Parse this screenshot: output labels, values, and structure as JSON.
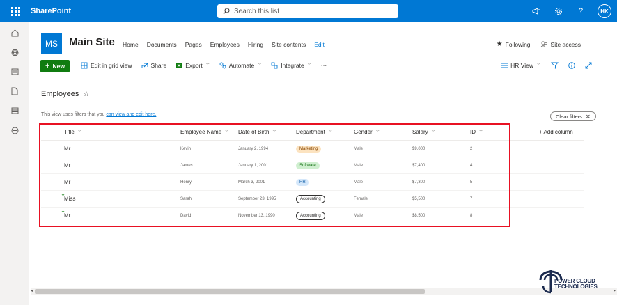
{
  "suite": {
    "app_name": "SharePoint",
    "search_placeholder": "Search this list",
    "avatar_initials": "HK"
  },
  "site": {
    "logo_initials": "MS",
    "title": "Main Site",
    "nav": [
      "Home",
      "Documents",
      "Pages",
      "Employees",
      "Hiring",
      "Site contents"
    ],
    "edit_label": "Edit",
    "following_label": "Following",
    "site_access_label": "Site access"
  },
  "commandbar": {
    "new_label": "New",
    "edit_grid_label": "Edit in grid view",
    "share_label": "Share",
    "export_label": "Export",
    "automate_label": "Automate",
    "integrate_label": "Integrate",
    "more_label": "···",
    "view_label": "HR View"
  },
  "list": {
    "title": "Employees",
    "filter_note": "This view uses filters that you ",
    "filter_link": "can view and edit here.",
    "clear_filters_label": "Clear filters"
  },
  "table": {
    "columns": [
      "Title",
      "Employee Name",
      "Date of Birth",
      "Department",
      "Gender",
      "Salary",
      "ID"
    ],
    "add_column_label": "+ Add column",
    "rows": [
      {
        "title": "Mr",
        "name": "Kevin",
        "dob": "January 2, 1994",
        "department": "Marketing",
        "dept_style": "marketing",
        "gender": "Male",
        "salary": "$9,000",
        "id": "2",
        "new": false
      },
      {
        "title": "Mr",
        "name": "James",
        "dob": "January 1, 2001",
        "department": "Software",
        "dept_style": "software",
        "gender": "Male",
        "salary": "$7,400",
        "id": "4",
        "new": false
      },
      {
        "title": "Mr",
        "name": "Henry",
        "dob": "March 3, 2001",
        "department": "HR",
        "dept_style": "hr",
        "gender": "Male",
        "salary": "$7,300",
        "id": "5",
        "new": false
      },
      {
        "title": "Miss",
        "name": "Sarah",
        "dob": "September 23, 1995",
        "department": "Accounting",
        "dept_style": "accounting",
        "gender": "Female",
        "salary": "$5,500",
        "id": "7",
        "new": true
      },
      {
        "title": "Mr",
        "name": "David",
        "dob": "November 13, 1990",
        "department": "Accounting",
        "dept_style": "accounting",
        "gender": "Male",
        "salary": "$8,500",
        "id": "8",
        "new": true
      }
    ]
  },
  "watermark": {
    "line1": "POWER CLOUD",
    "line2": "TECHNOLOGIES"
  },
  "colors": {
    "brand": "#0078d4",
    "new_button": "#107c10",
    "highlight_box": "#e81123"
  }
}
